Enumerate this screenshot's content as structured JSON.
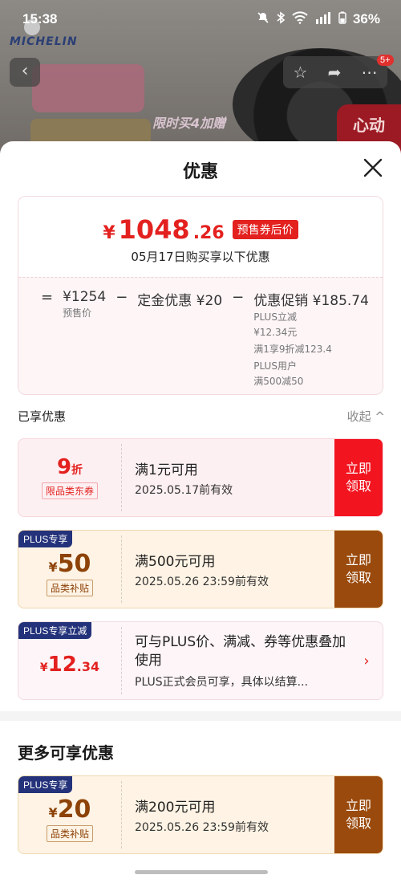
{
  "status_bar": {
    "time": "15:38",
    "battery": "36%"
  },
  "background": {
    "brand": "MICHELIN",
    "promo_text": "限时买4加赠",
    "side_banner": "心动",
    "cart_count": "5+"
  },
  "sheet": {
    "title": "优惠",
    "summary": {
      "currency": "¥",
      "price_int": "1048",
      "price_dec": ".26",
      "price_tag": "预售券后价",
      "date_line": "05月17日购买享以下优惠",
      "calc": {
        "eq": "=",
        "presale_price": "¥1254",
        "presale_label": "预售价",
        "minus1": "−",
        "deposit": "定金优惠 ¥20",
        "minus2": "−",
        "promo": "优惠促销 ¥185.74",
        "promo_line1a": "PLUS立减",
        "promo_line1b": "¥12.34元",
        "promo_line2": "满1享9折减123.4",
        "promo_line3a": "PLUS用户",
        "promo_line3b": "满500减50"
      }
    },
    "applied": {
      "title": "已享优惠",
      "collapse": "收起 ^"
    },
    "coupons": [
      {
        "value": "9",
        "unit": "折",
        "label": "限品类东券",
        "condition": "满1元可用",
        "validity": "2025.05.17前有效",
        "button": "立即领取"
      },
      {
        "tag": "PLUS专享",
        "currency": "¥",
        "value": "50",
        "label": "品类补贴",
        "condition": "满500元可用",
        "validity": "2025.05.26 23:59前有效",
        "button": "立即领取"
      },
      {
        "tag": "PLUS专享立减",
        "currency": "¥",
        "value": "12",
        "decimal": ".34",
        "line1": "可与PLUS价、满减、券等优惠叠加使用",
        "line2": "PLUS正式会员可享，具体以结算..."
      }
    ],
    "more": {
      "title": "更多可享优惠",
      "coupon": {
        "tag": "PLUS专享",
        "currency": "¥",
        "value": "20",
        "label": "品类补贴",
        "condition": "满200元可用",
        "validity": "2025.05.26 23:59前有效",
        "button": "立即领取"
      }
    }
  }
}
